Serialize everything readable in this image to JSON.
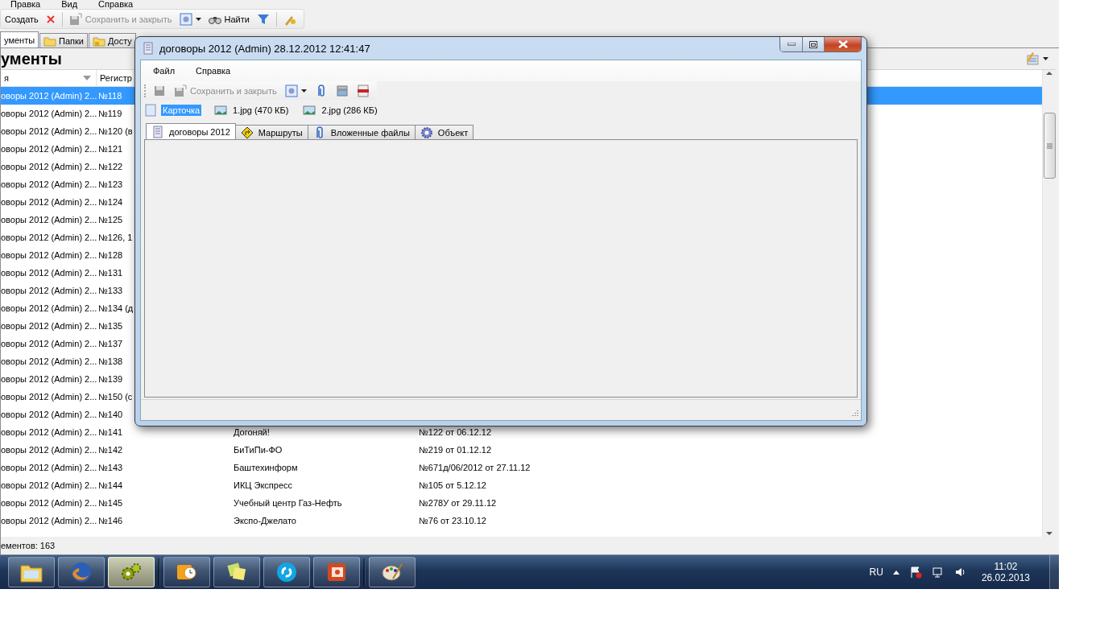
{
  "main_window": {
    "menu": [
      "Правка",
      "Вид",
      "Справка"
    ],
    "toolbar": {
      "create": "Создать",
      "save_close": {
        "label": "Сохранить и закрыть",
        "disabled": true
      },
      "find": "Найти"
    },
    "tabs": [
      {
        "label": "ументы",
        "selected": true
      },
      {
        "label": "Папки",
        "kind": "folders",
        "selected": false
      },
      {
        "label": "Досту",
        "kind": "access",
        "selected": false
      }
    ],
    "heading": "ументы",
    "columns": [
      "я",
      "Регистр"
    ],
    "rows": [
      {
        "cells": [
          "оворы 2012 (Admin) 2...",
          "№118"
        ],
        "selected": true
      },
      {
        "cells": [
          "оворы 2012 (Admin) 2...",
          "№119"
        ],
        "selected": false
      },
      {
        "cells": [
          "оворы 2012 (Admin) 2...",
          "№120 (в"
        ],
        "selected": false
      },
      {
        "cells": [
          "оворы 2012 (Admin) 2...",
          "№121"
        ],
        "selected": false
      },
      {
        "cells": [
          "оворы 2012 (Admin) 2...",
          "№122"
        ],
        "selected": false
      },
      {
        "cells": [
          "оворы 2012 (Admin) 2...",
          "№123"
        ],
        "selected": false
      },
      {
        "cells": [
          "оворы 2012 (Admin) 2...",
          "№124"
        ],
        "selected": false
      },
      {
        "cells": [
          "оворы 2012 (Admin) 2...",
          "№125"
        ],
        "selected": false
      },
      {
        "cells": [
          "оворы 2012 (Admin) 2...",
          "№126, 1"
        ],
        "selected": false
      },
      {
        "cells": [
          "оворы 2012 (Admin) 2...",
          "№128"
        ],
        "selected": false
      },
      {
        "cells": [
          "оворы 2012 (Admin) 2...",
          "№131"
        ],
        "selected": false
      },
      {
        "cells": [
          "оворы 2012 (Admin) 2...",
          "№133"
        ],
        "selected": false
      },
      {
        "cells": [
          "оворы 2012 (Admin) 2...",
          "№134 (д"
        ],
        "selected": false
      },
      {
        "cells": [
          "оворы 2012 (Admin) 2...",
          "№135"
        ],
        "selected": false
      },
      {
        "cells": [
          "оворы 2012 (Admin) 2...",
          "№137"
        ],
        "selected": false
      },
      {
        "cells": [
          "оворы 2012 (Admin) 2...",
          "№138"
        ],
        "selected": false
      },
      {
        "cells": [
          "оворы 2012 (Admin) 2...",
          "№139"
        ],
        "selected": false
      },
      {
        "cells": [
          "оворы 2012 (Admin) 2...",
          "№150 (с"
        ],
        "selected": false
      },
      {
        "cells": [
          "оворы 2012 (Admin) 2...",
          "№140"
        ],
        "selected": false
      },
      {
        "cells": [
          "оворы 2012 (Admin) 2...",
          "№141",
          "Догоняй!",
          "№122 от 06.12.12"
        ],
        "selected": false
      },
      {
        "cells": [
          "оворы 2012 (Admin) 2...",
          "№142",
          "БиТиПи-ФО",
          "№219 от 01.12.12"
        ],
        "selected": false
      },
      {
        "cells": [
          "оворы 2012 (Admin) 2...",
          "№143",
          "Баштехинформ",
          "№671д/06/2012 от 27.11.12"
        ],
        "selected": false
      },
      {
        "cells": [
          "оворы 2012 (Admin) 2...",
          "№144",
          "ИКЦ Экспресс",
          "№105 от 5.12.12"
        ],
        "selected": false
      },
      {
        "cells": [
          "оворы 2012 (Admin) 2...",
          "№145",
          "Учебный центр Газ-Нефть",
          "№278У от 29.11.12"
        ],
        "selected": false
      },
      {
        "cells": [
          "оворы 2012 (Admin) 2...",
          "№146",
          "Экспо-Джелато",
          "№76 от 23.10.12"
        ],
        "selected": false
      }
    ],
    "status_bar": "ементов: 163"
  },
  "dialog": {
    "title": "договоры 2012 (Admin) 28.12.2012 12:41:47",
    "menu": [
      "Файл",
      "Справка"
    ],
    "toolbar": {
      "save_close": {
        "label": "Сохранить и закрыть",
        "disabled": true
      }
    },
    "attachments": [
      {
        "label": "Карточка",
        "kind": "card",
        "selected": true
      },
      {
        "label": "1.jpg (470 КБ)",
        "kind": "image",
        "selected": false
      },
      {
        "label": "2.jpg (286 КБ)",
        "kind": "image",
        "selected": false
      }
    ],
    "tabs": [
      {
        "label": "договоры 2012",
        "kind": "document",
        "selected": true
      },
      {
        "label": "Маршруты",
        "kind": "route",
        "selected": false
      },
      {
        "label": "Вложенные файлы",
        "kind": "attachment",
        "selected": false
      },
      {
        "label": "Объект",
        "kind": "object",
        "selected": false
      }
    ]
  },
  "taskbar": {
    "buttons": [
      {
        "kind": "folder",
        "active": false
      },
      {
        "kind": "browser",
        "active": false
      },
      {
        "kind": "gears",
        "active": true
      },
      {
        "kind": "mail",
        "active": false
      },
      {
        "kind": "notes",
        "active": false
      },
      {
        "kind": "chat",
        "active": false
      },
      {
        "kind": "slides",
        "active": false
      },
      {
        "kind": "paint",
        "active": false
      }
    ],
    "language": "RU",
    "time": "11:02",
    "date": "26.02.2013"
  }
}
